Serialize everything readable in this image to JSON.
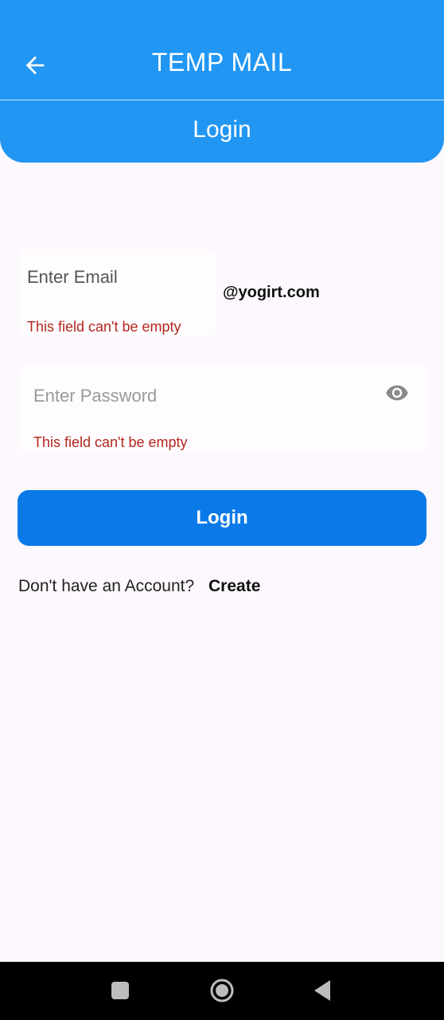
{
  "appbar": {
    "title": "TEMP MAIL",
    "subtitle": "Login",
    "back_icon": "arrow-back-icon",
    "color": "#2196f3"
  },
  "email": {
    "placeholder": "Enter Email",
    "value": "",
    "error": "This field can't be empty",
    "domain_suffix": "@yogirt.com"
  },
  "password": {
    "placeholder": "Enter Password",
    "value": "",
    "error": "This field can't be empty",
    "visibility_icon": "eye-icon"
  },
  "login_button": {
    "label": "Login",
    "color": "#0a7ae8"
  },
  "account_prompt": {
    "text": "Don't have an Account?",
    "link": "Create"
  },
  "system_nav": {
    "icons": [
      "recents-icon",
      "home-icon",
      "back-icon"
    ]
  },
  "colors": {
    "error": "#b3261e",
    "background": "#fdf8fd"
  }
}
